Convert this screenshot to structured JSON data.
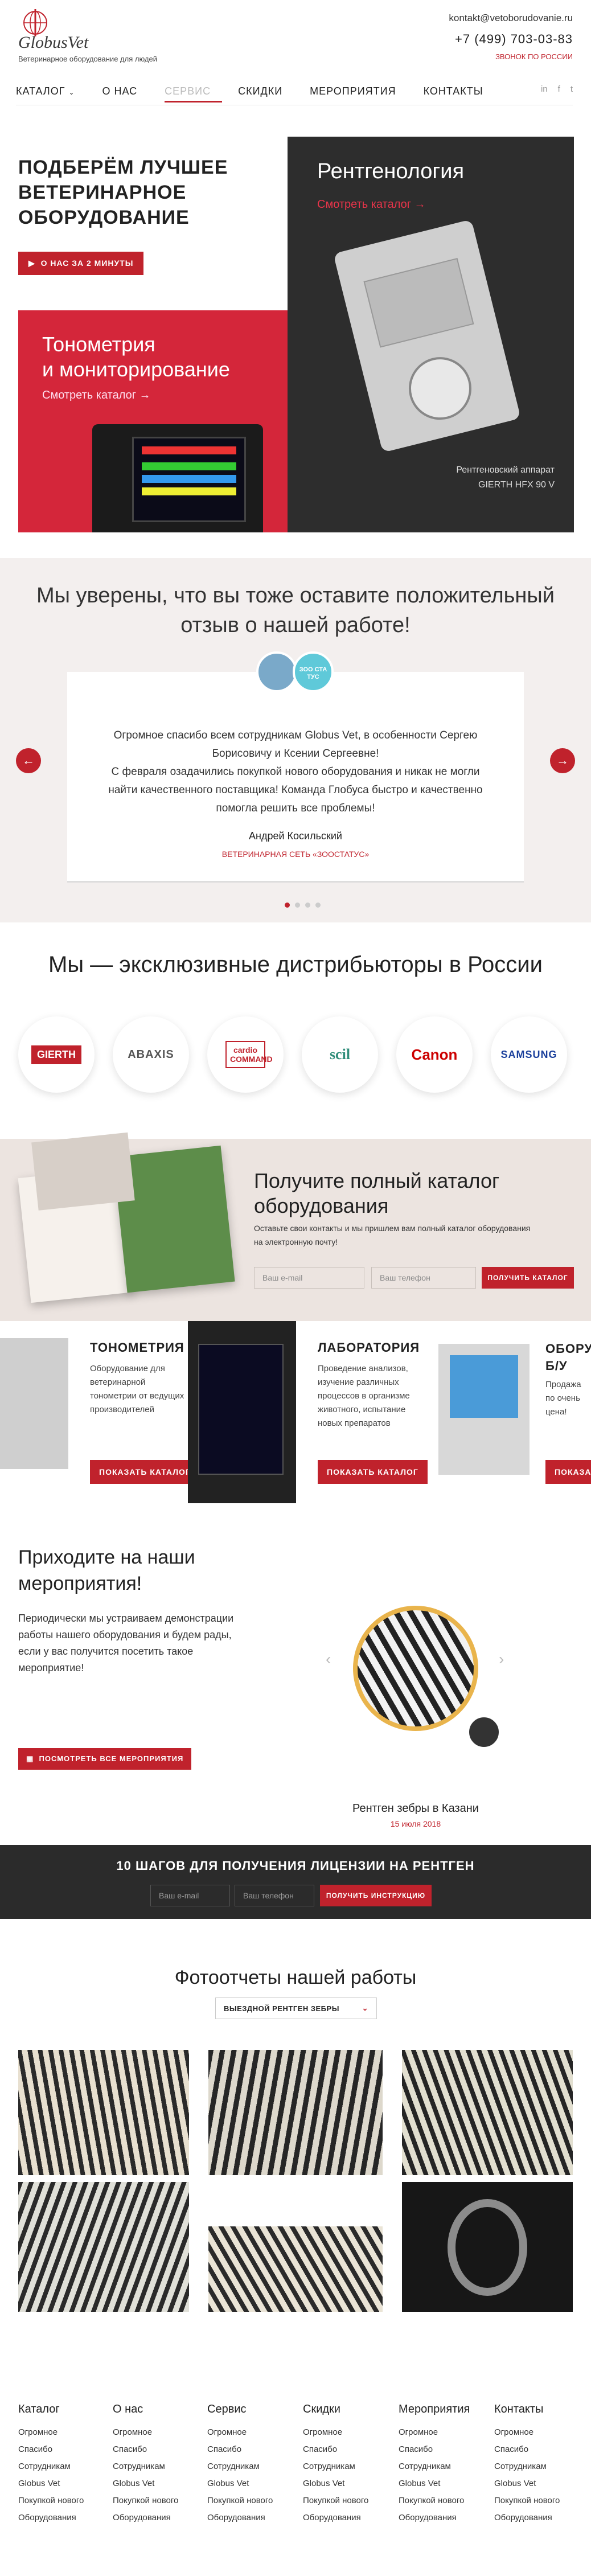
{
  "header": {
    "logo_text": "GlobusVet",
    "logo_sub": "Ветеринарное оборудование для людей",
    "email": "kontakt@vetoborudovanie.ru",
    "phone": "+7 (499) 703-03-83",
    "call_free": "ЗВОНОК ПО РОССИИ"
  },
  "nav": [
    {
      "label": "КАТАЛОГ"
    },
    {
      "label": "О НАС"
    },
    {
      "label": "СЕРВИС"
    },
    {
      "label": "СКИДКИ"
    },
    {
      "label": "МЕРОПРИЯТИЯ"
    },
    {
      "label": "КОНТАКТЫ"
    }
  ],
  "social_icons": [
    "vk-icon",
    "facebook-icon",
    "twitter-icon"
  ],
  "hero": {
    "title_1": "ПОДБЕРЁМ ЛУЧШЕЕ",
    "title_2": "ВЕТЕРИНАРНОЕ",
    "title_3": "ОБОРУДОВАНИЕ",
    "button": "О НАС ЗА 2 МИНУТЫ",
    "tono_title_1": "Тонометрия",
    "tono_title_2": "и мониторирование",
    "tono_link": "Смотреть каталог →",
    "rent_title": "Рентгенология",
    "rent_link": "Смотреть каталог →",
    "rent_cap_1": "Рентгеновский аппарат",
    "rent_cap_2": "GIERTH HFX 90 V"
  },
  "reviews": {
    "title_1": "Мы уверены, что вы тоже оставите положительный",
    "title_2": "отзыв о нашей работе!",
    "logo_text": "ЗОО СТА ТУС",
    "text_1": "Огромное спасибо всем сотрудникам Globus Vet, в особенности Сергею",
    "text_2": "Борисовичу и Ксении Сергеевне!",
    "text_3": "С февраля озадачились покупкой нового оборудования и никак не могли",
    "text_4": "найти качественного поставщика! Команда Глобуса быстро и качественно",
    "text_5": "помогла решить все проблемы!",
    "author": "Андрей Косильский",
    "org": "ВЕТЕРИНАРНАЯ СЕТЬ «ЗООСТАТУС»"
  },
  "distributors": {
    "title": "Мы — эксклюзивные дистрибьюторы в России",
    "brands": [
      "GIERTH",
      "ABAXIS",
      "cardio COMMAND",
      "scil",
      "Canon",
      "SAMSUNG"
    ]
  },
  "catalog_request": {
    "title_1": "Получите полный каталог",
    "title_2": "оборудования",
    "desc_1": "Оставьте свои контакты и мы пришлем вам полный каталог оборудования",
    "desc_2": "на электронную почту!",
    "email_placeholder": "Ваш e-mail",
    "phone_placeholder": "Ваш телефон",
    "button": "ПОЛУЧИТЬ КАТАЛОГ"
  },
  "cards": [
    {
      "title": "ТОНОМЕТРИЯ",
      "desc": [
        "Оборудование для",
        "ветеринарной",
        "тонометрии от ведущих",
        "производителей"
      ],
      "button": "ПОКАЗАТЬ КАТАЛОГ"
    },
    {
      "title": "ЛАБОРАТОРИЯ",
      "desc": [
        "Проведение анализов,",
        "изучение различных",
        "процессов в организме",
        "животного, испытание",
        "новых препаратов"
      ],
      "button": "ПОКАЗАТЬ КАТАЛОГ"
    },
    {
      "title": "ОБОРУ",
      "title_2": "Б/У",
      "desc": [
        "Продажа",
        "по очень",
        "цена!"
      ],
      "button": "ПОКАЗА"
    }
  ],
  "events": {
    "title_1": "Приходите  на наши",
    "title_2": "мероприятия!",
    "desc_1": "Периодически мы устраиваем демонстрации",
    "desc_2": "работы нашего оборудования и будем рады,",
    "desc_3": "если у вас получится посетить такое",
    "desc_4": "мероприятие!",
    "button": "ПОСМОТРЕТЬ ВСЕ МЕРОПРИЯТИЯ",
    "caption": "Рентген зебры в Казани",
    "date": "15 июля 2018"
  },
  "license": {
    "title": "10 ШАГОВ ДЛЯ ПОЛУЧЕНИЯ ЛИЦЕНЗИИ НА РЕНТГЕН",
    "email_placeholder": "Ваш e-mail",
    "phone_placeholder": "Ваш телефон",
    "button": "ПОЛУЧИТЬ ИНСТРУКЦИЮ"
  },
  "photos": {
    "title": "Фотоотчеты нашей работы",
    "select_value": "ВЫЕЗДНОЙ РЕНТГЕН ЗЕБРЫ"
  },
  "footer": {
    "columns": [
      {
        "head": "Каталог",
        "items": [
          "Огромное",
          "Спасибо",
          "Сотрудникам",
          "Globus Vet",
          "Покупкой нового",
          "Оборудования"
        ]
      },
      {
        "head": "О нас",
        "items": [
          "Огромное",
          "Спасибо",
          "Сотрудникам",
          "Globus Vet",
          "Покупкой нового",
          "Оборудования"
        ]
      },
      {
        "head": "Сервис",
        "items": [
          "Огромное",
          "Спасибо",
          "Сотрудникам",
          "Globus Vet",
          "Покупкой нового",
          "Оборудования"
        ]
      },
      {
        "head": "Скидки",
        "items": [
          "Огромное",
          "Спасибо",
          "Сотрудникам",
          "Globus Vet",
          "Покупкой нового",
          "Оборудования"
        ]
      },
      {
        "head": "Мероприятия",
        "items": [
          "Огромное",
          "Спасибо",
          "Сотрудникам",
          "Globus Vet",
          "Покупкой нового",
          "Оборудования"
        ]
      },
      {
        "head": "Контакты",
        "items": [
          "Огромное",
          "Спасибо",
          "Сотрудникам",
          "Globus Vet",
          "Покупкой нового",
          "Оборудования"
        ]
      }
    ]
  },
  "colors": {
    "accent": "#c0222c",
    "dark": "#2b2b2b",
    "beige": "#ece4e0"
  }
}
